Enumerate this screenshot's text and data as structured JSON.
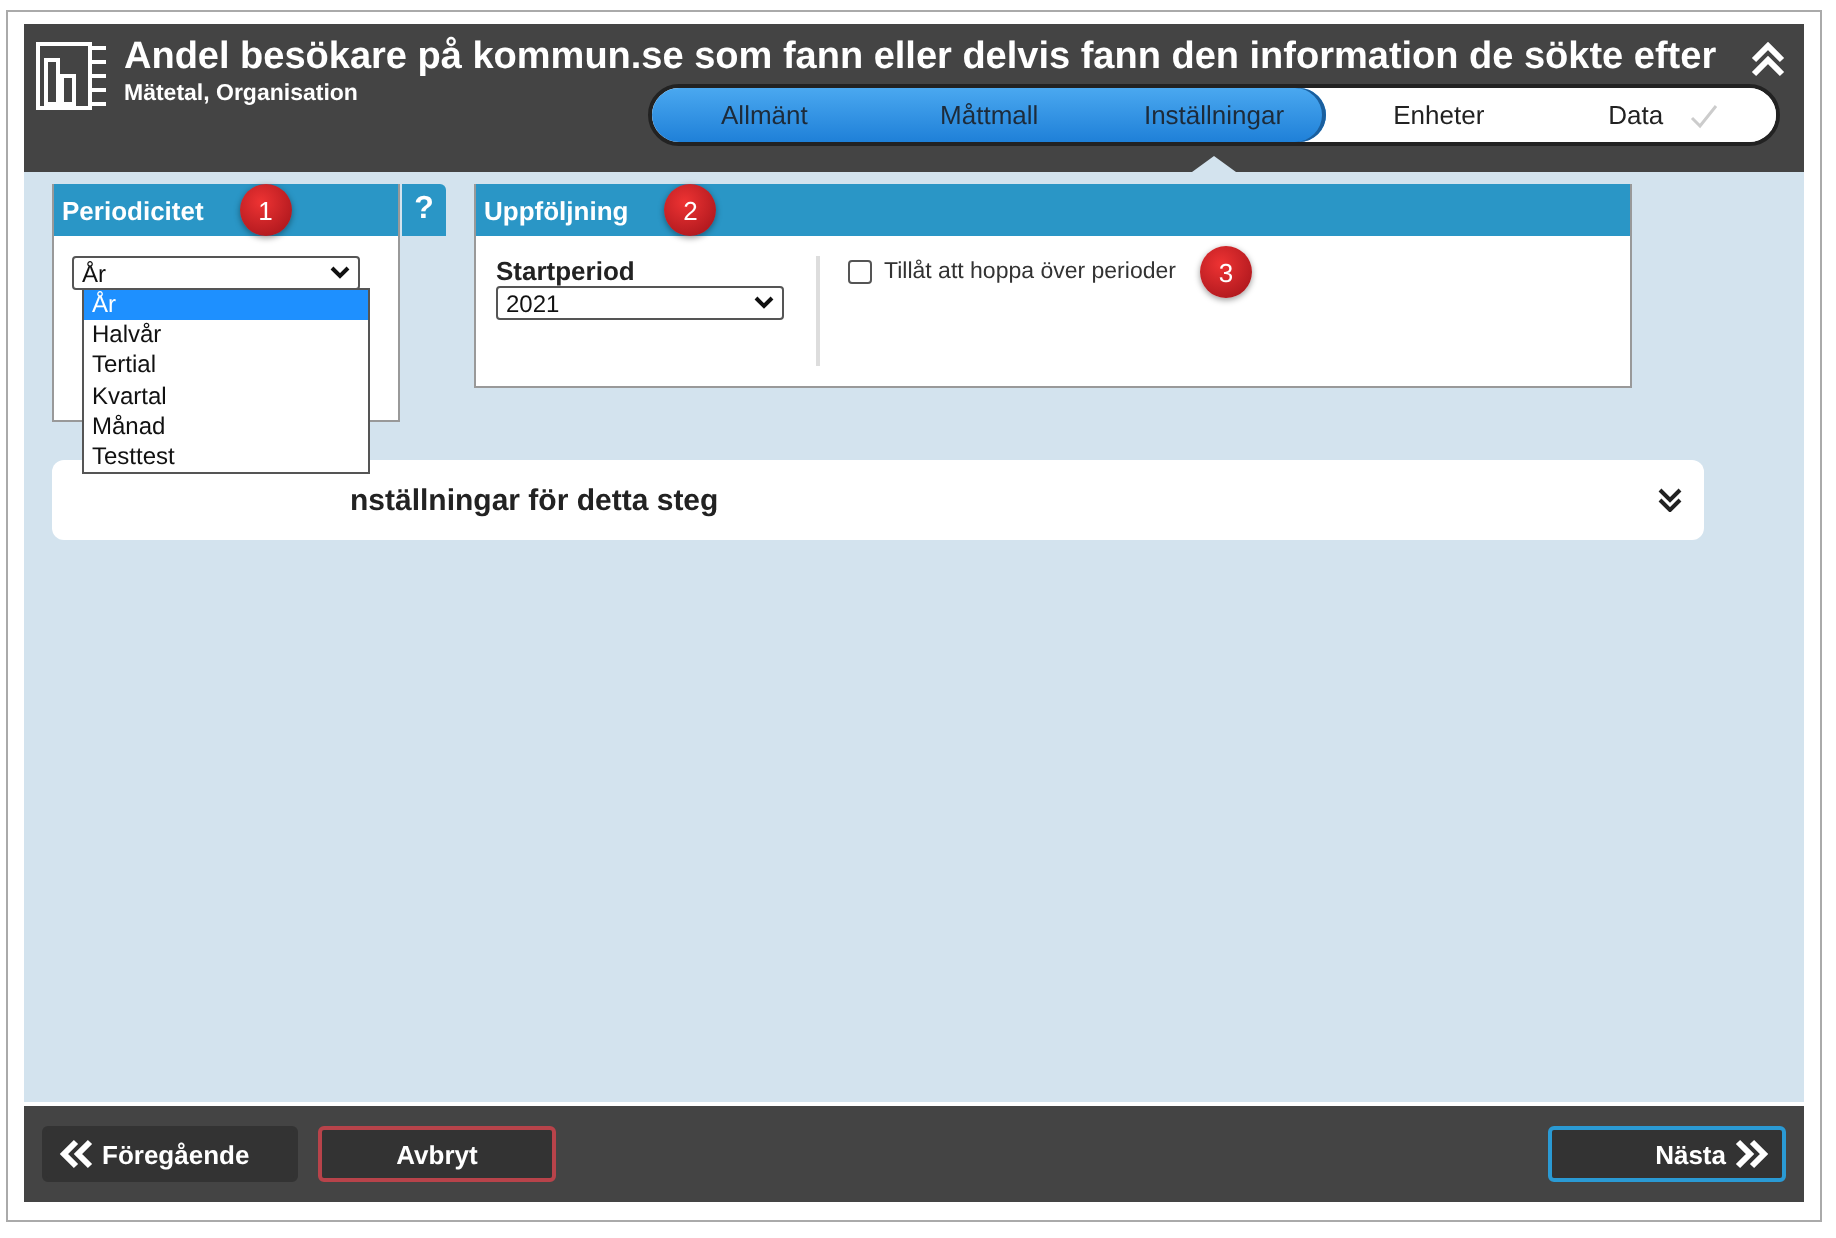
{
  "header": {
    "title": "Andel besökare på kommun.se som fann eller delvis fann den information de sökte efter",
    "subtitle": "Mätetal, Organisation",
    "steps": [
      {
        "label": "Allmänt",
        "completed": true,
        "selected": false
      },
      {
        "label": "Måttmall",
        "completed": true,
        "selected": false
      },
      {
        "label": "Inställningar",
        "completed": true,
        "selected": true
      },
      {
        "label": "Enheter",
        "completed": false,
        "selected": false
      },
      {
        "label": "Data",
        "completed": false,
        "selected": false
      }
    ]
  },
  "periodicity": {
    "title": "Periodicitet",
    "badge": "1",
    "help": "?",
    "value": "År",
    "options": [
      {
        "label": "År",
        "selected": true
      },
      {
        "label": "Halvår",
        "selected": false
      },
      {
        "label": "Tertial",
        "selected": false
      },
      {
        "label": "Kvartal",
        "selected": false
      },
      {
        "label": "Månad",
        "selected": false
      },
      {
        "label": "Testtest",
        "selected": false
      }
    ]
  },
  "followup": {
    "title": "Uppföljning",
    "badge": "2",
    "start_label": "Startperiod",
    "start_value": "2021",
    "skip_label": "Tillåt att hoppa över perioder",
    "skip_checked": false,
    "skip_badge": "3"
  },
  "section": {
    "title": "nställningar för detta steg",
    "expanded": false
  },
  "footer": {
    "previous": "Föregående",
    "cancel": "Avbryt",
    "next": "Nästa"
  }
}
